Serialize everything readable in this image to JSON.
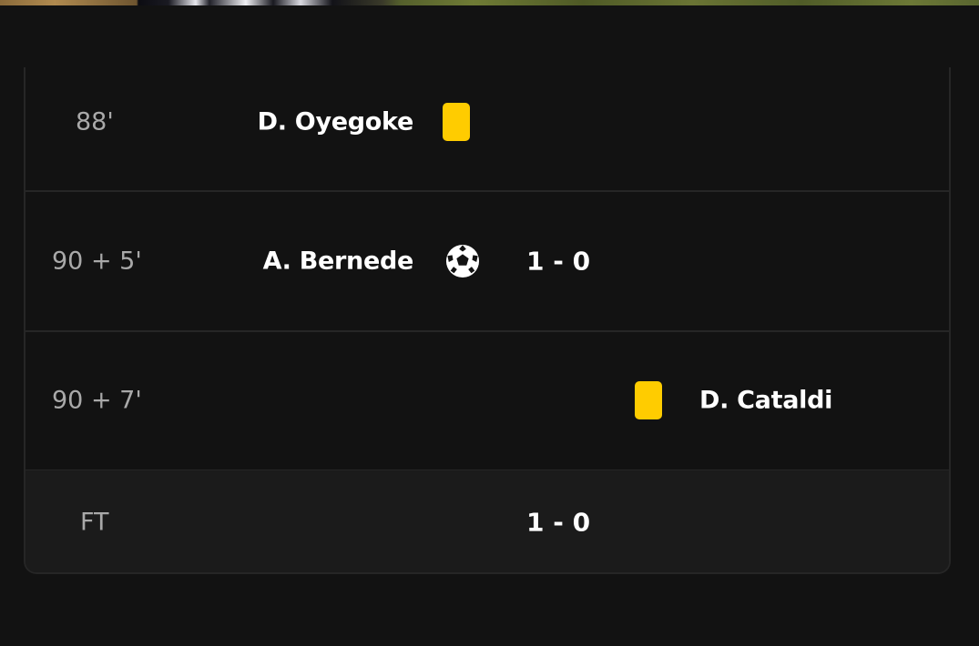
{
  "events": [
    {
      "minute": "88'",
      "home_player": "D. Oyegoke",
      "event_icon": "yellow-card-icon"
    },
    {
      "minute": "90 + 5'",
      "home_player": "A. Bernede",
      "event_icon": "soccer-ball-icon",
      "score": "1 - 0"
    },
    {
      "minute": "90 + 7'",
      "away_player": "D. Cataldi",
      "event_icon": "yellow-card-icon"
    }
  ],
  "full_time": {
    "label": "FT",
    "score": "1 - 0"
  },
  "colors": {
    "background": "#121212",
    "card_border": "#262626",
    "ft_row_background": "#1b1b1b",
    "minute_text": "#a9a9a9",
    "yellow_card": "#ffcc00",
    "text": "#ffffff"
  }
}
